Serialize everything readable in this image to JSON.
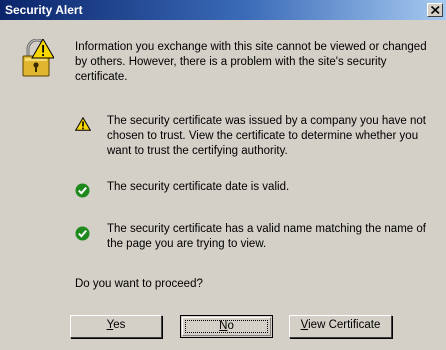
{
  "dialog": {
    "title": "Security Alert",
    "intro": "Information you exchange with this site cannot be viewed or changed by others. However, there is a problem with the site's security certificate.",
    "items": [
      {
        "icon": "warning-icon",
        "text": "The security certificate was issued by a company you have not chosen to trust. View the certificate to determine whether you want to trust the certifying authority."
      },
      {
        "icon": "check-icon",
        "text": "The security certificate date is valid."
      },
      {
        "icon": "check-icon",
        "text": "The security certificate has a valid name matching the name of the page you are trying to view."
      }
    ],
    "question": "Do you want to proceed?",
    "buttons": {
      "yes_accel": "Y",
      "yes_rest": "es",
      "no_accel": "N",
      "no_rest": "o",
      "view_accel": "V",
      "view_rest": "iew Certificate"
    }
  },
  "colors": {
    "titlebar_start": "#0a246a",
    "titlebar_end": "#a6caf0",
    "face": "#d4d0c8",
    "warning": "#f8d800",
    "success": "#1e8a1e"
  }
}
